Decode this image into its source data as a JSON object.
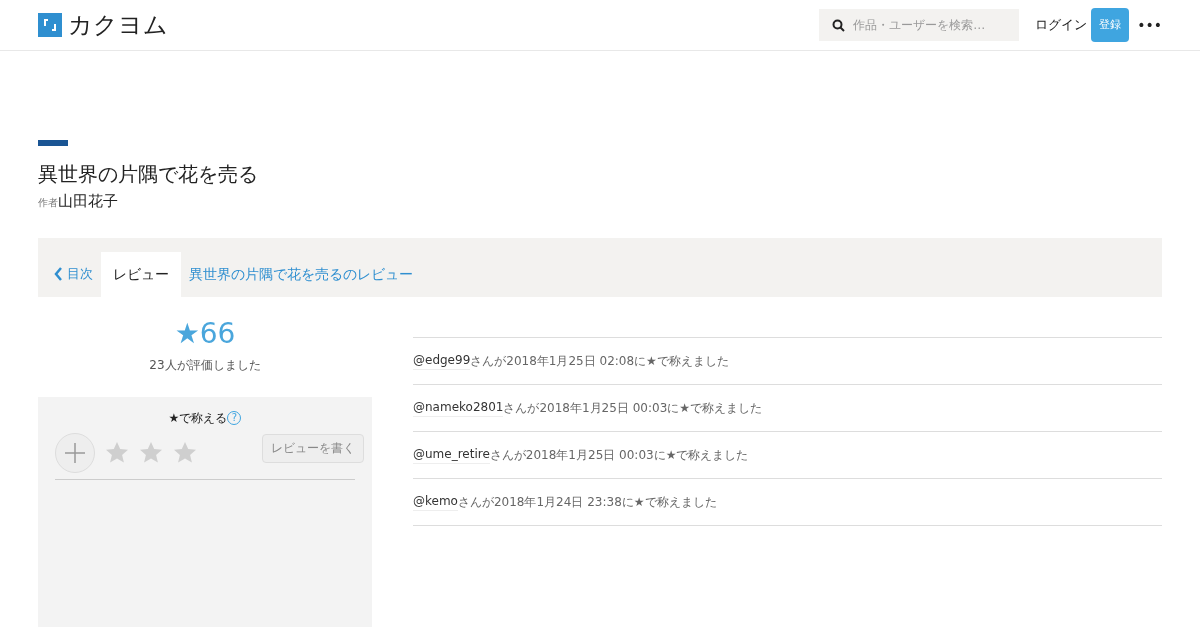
{
  "header": {
    "site_name": "カクヨム",
    "search": {
      "placeholder": "作品・ユーザーを検索…"
    },
    "login": "ログイン",
    "register": "登録",
    "menu": "•••"
  },
  "work": {
    "title": "異世界の片隅で花を売る",
    "author_prefix": "作者",
    "author": "山田花子"
  },
  "nav": {
    "back": "目次",
    "tab": "レビュー",
    "link": "異世界の片隅で花を売るのレビュー"
  },
  "rating": {
    "score": "★66",
    "count": "23人が評価しました"
  },
  "panel": {
    "title": "★で称える",
    "help": "?",
    "stars": 0,
    "write_button": "レビューを書く"
  },
  "reviews": [
    {
      "user": "@edge99",
      "text": "さんが2018年1月25日 02:08に★で称えました"
    },
    {
      "user": "@nameko2801",
      "text": "さんが2018年1月25日 00:03に★で称えました"
    },
    {
      "user": "@ume_retire",
      "text": "さんが2018年1月25日 00:03に★で称えました"
    },
    {
      "user": "@kemo",
      "text": "さんが2018年1月24日 23:38に★で称えました"
    }
  ]
}
